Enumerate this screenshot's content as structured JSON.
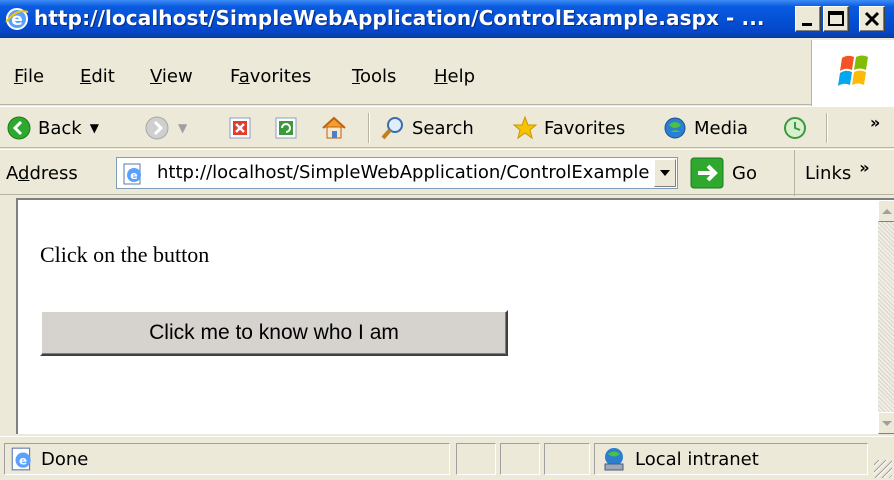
{
  "window": {
    "title": "http://localhost/SimpleWebApplication/ControlExample.aspx - ..."
  },
  "menu": {
    "items": [
      {
        "label": "File",
        "accel": "F"
      },
      {
        "label": "Edit",
        "accel": "E"
      },
      {
        "label": "View",
        "accel": "V"
      },
      {
        "label": "Favorites",
        "accel": "a"
      },
      {
        "label": "Tools",
        "accel": "T"
      },
      {
        "label": "Help",
        "accel": "H"
      }
    ]
  },
  "toolbar": {
    "back_label": "Back",
    "search_label": "Search",
    "favorites_label": "Favorites",
    "media_label": "Media",
    "overflow": "»"
  },
  "address": {
    "label": "Address",
    "accel": "d",
    "url": "http://localhost/SimpleWebApplication/ControlExample.aspx",
    "go_label": "Go",
    "links_label": "Links",
    "links_overflow": "»"
  },
  "page": {
    "instruction_text": "Click on the button",
    "button_label": "Click me to know who I am"
  },
  "status": {
    "text": "Done",
    "zone": "Local intranet"
  },
  "colors": {
    "titlebar": "#0551d6",
    "chrome": "#ece9d8",
    "go_green": "#2fa82f"
  }
}
